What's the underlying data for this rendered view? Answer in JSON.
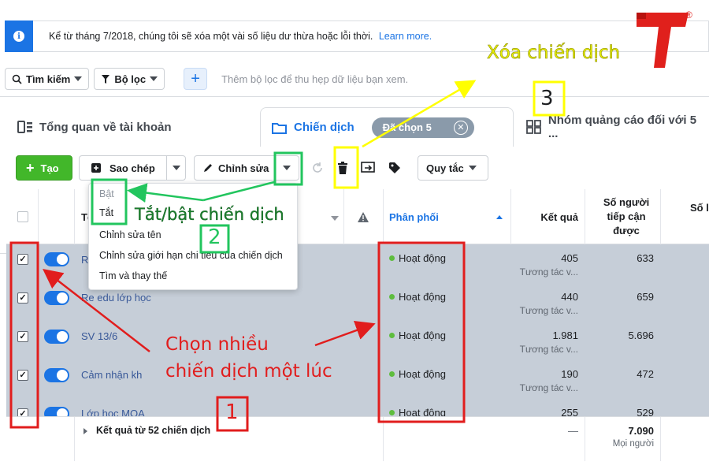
{
  "notice": {
    "text": "Kể từ tháng 7/2018, chúng tôi sẽ xóa một vài số liệu dư thừa hoặc lỗi thời.",
    "link": "Learn more."
  },
  "filters": {
    "search_label": "Tìm kiếm",
    "filter_label": "Bộ lọc",
    "add_label": "+",
    "placeholder": "Thêm bộ lọc để thu hẹp dữ liệu bạn xem."
  },
  "tabs": {
    "overview": "Tổng quan về tài khoản",
    "campaigns": "Chiến dịch",
    "selected_pill": "Đã chọn 5",
    "pill_close": "✕",
    "adsets": "Nhóm quảng cáo đối với 5 ..."
  },
  "toolbar": {
    "create": "Tạo",
    "copy": "Sao chép",
    "edit": "Chỉnh sửa",
    "rules": "Quy tắc"
  },
  "table": {
    "headers": {
      "name": "Tê",
      "delivery": "Phân phối",
      "results": "Kết quả",
      "reach": "Số người tiếp cận được",
      "impressions": "Số l"
    },
    "rows": [
      {
        "name": "R",
        "status": "Hoạt động",
        "results": "405",
        "results_sub": "Tương tác v...",
        "reach": "633"
      },
      {
        "name": "Re edu lớp học",
        "status": "Hoạt động",
        "results": "440",
        "results_sub": "Tương tác v...",
        "reach": "659"
      },
      {
        "name": "SV 13/6",
        "status": "Hoạt động",
        "results": "1.981",
        "results_sub": "Tương tác v...",
        "reach": "5.696"
      },
      {
        "name": "Cảm nhận kh",
        "status": "Hoạt động",
        "results": "190",
        "results_sub": "Tương tác v...",
        "reach": "472"
      },
      {
        "name": "Lớp học MOA",
        "status": "Hoạt động",
        "results": "255",
        "results_sub": "",
        "reach": "529"
      }
    ],
    "summary": {
      "label": "Kết quả từ 52 chiến dịch",
      "results": "—",
      "reach": "7.090",
      "reach_sub": "Mọi người"
    }
  },
  "dropdown": {
    "items": [
      "Bật",
      "Tắt",
      "Chỉnh sửa tên",
      "Chỉnh sửa giới hạn chi tiêu của chiến dịch",
      "Tìm và thay thế"
    ]
  },
  "annotations": {
    "delete_label": "Xóa chiến dịch",
    "delete_number": "3",
    "toggle_label": "Tắt/bật chiến dịch",
    "toggle_number": "2",
    "select_label_line1": "Chọn nhiều",
    "select_label_line2": "chiến dịch một lúc",
    "select_number": "1",
    "yellow": "#ffff00",
    "green": "#22c55e",
    "red": "#e11d1d"
  },
  "logo": {
    "mark": "®",
    "color": "#e0201c"
  }
}
